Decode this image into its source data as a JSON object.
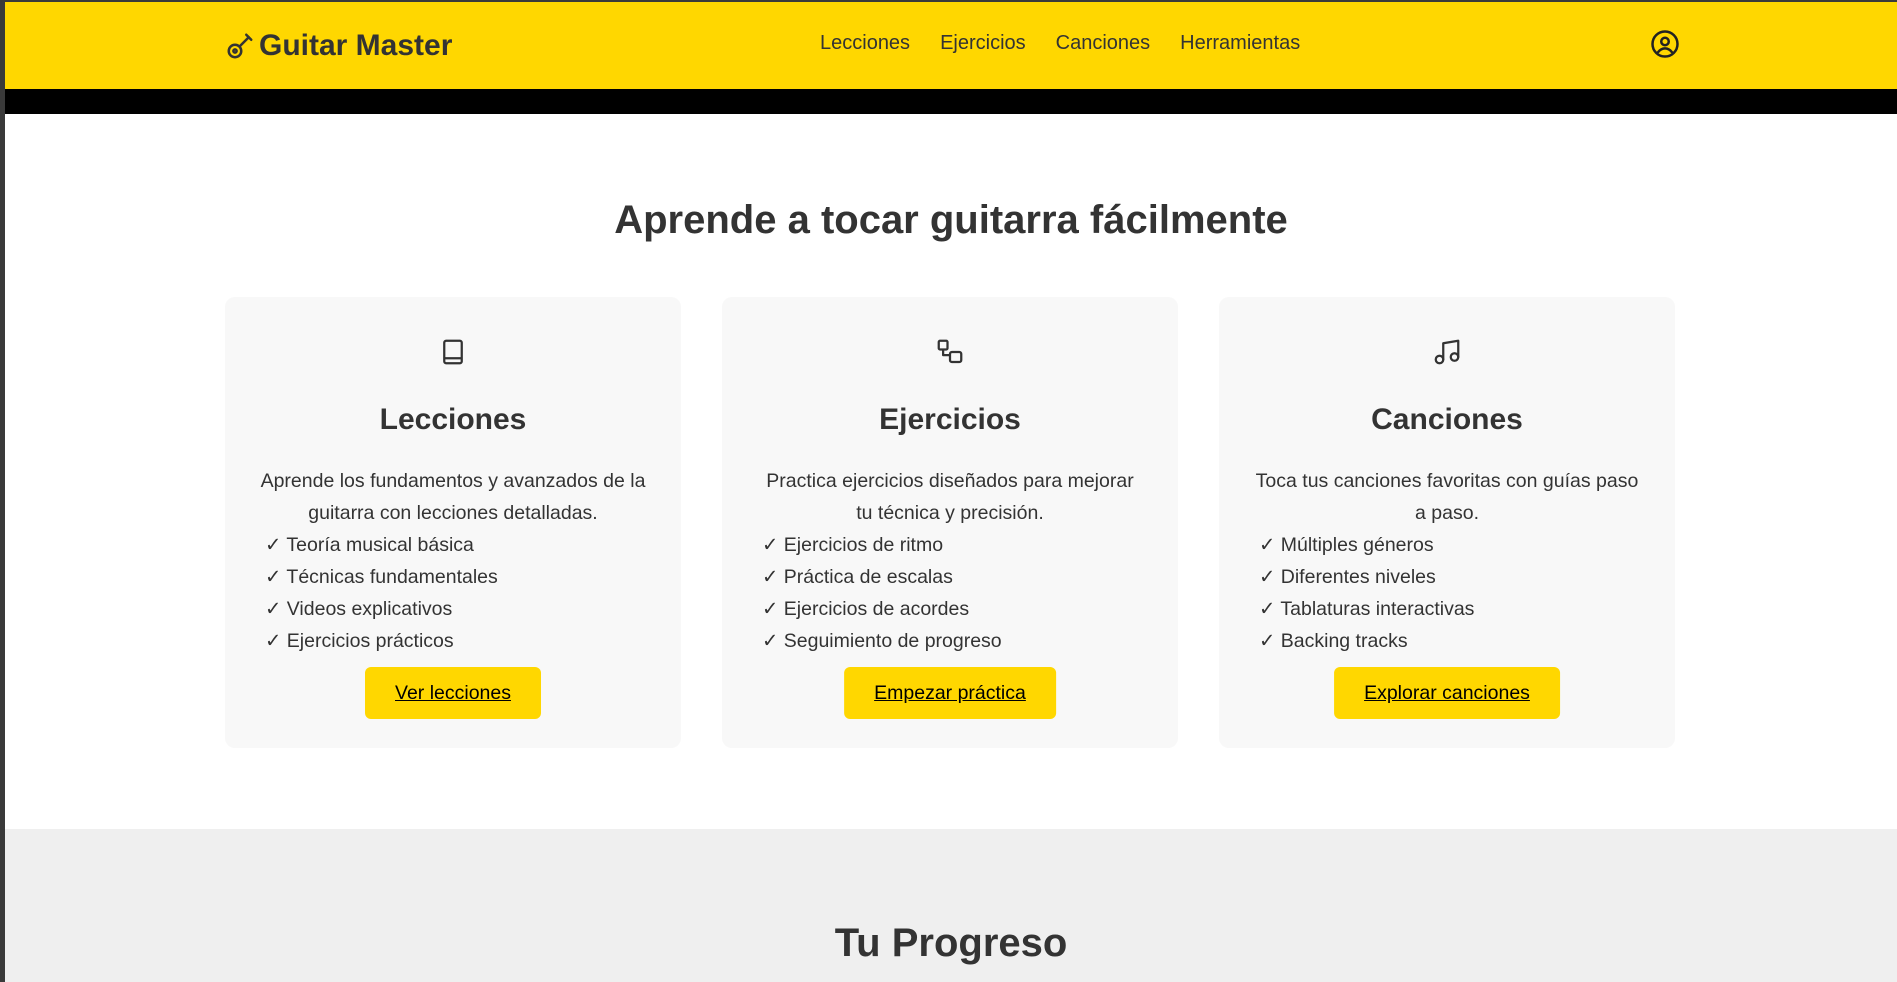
{
  "header": {
    "brand": "Guitar Master",
    "nav": [
      "Lecciones",
      "Ejercicios",
      "Canciones",
      "Herramientas"
    ],
    "icons": {
      "brand": "guitar-icon",
      "user": "user-circle-icon"
    },
    "accent_color": "#FFD700"
  },
  "hero": {
    "title": "Aprende a tocar guitarra fácilmente"
  },
  "cards": [
    {
      "icon": "book-icon",
      "title": "Lecciones",
      "description": "Aprende los fundamentos y avanzados de la guitarra con lecciones detalladas.",
      "features": [
        "Teoría musical básica",
        "Técnicas fundamentales",
        "Videos explicativos",
        "Ejercicios prácticos"
      ],
      "button": "Ver lecciones"
    },
    {
      "icon": "exercise-icon",
      "title": "Ejercicios",
      "description": "Practica ejercicios diseñados para mejorar tu técnica y precisión.",
      "features": [
        "Ejercicios de ritmo",
        "Práctica de escalas",
        "Ejercicios de acordes",
        "Seguimiento de progreso"
      ],
      "button": "Empezar práctica"
    },
    {
      "icon": "music-note-icon",
      "title": "Canciones",
      "description": "Toca tus canciones favoritas con guías paso a paso.",
      "features": [
        "Múltiples géneros",
        "Diferentes niveles",
        "Tablaturas interactivas",
        "Backing tracks"
      ],
      "button": "Explorar canciones"
    }
  ],
  "progress": {
    "title": "Tu Progreso"
  }
}
